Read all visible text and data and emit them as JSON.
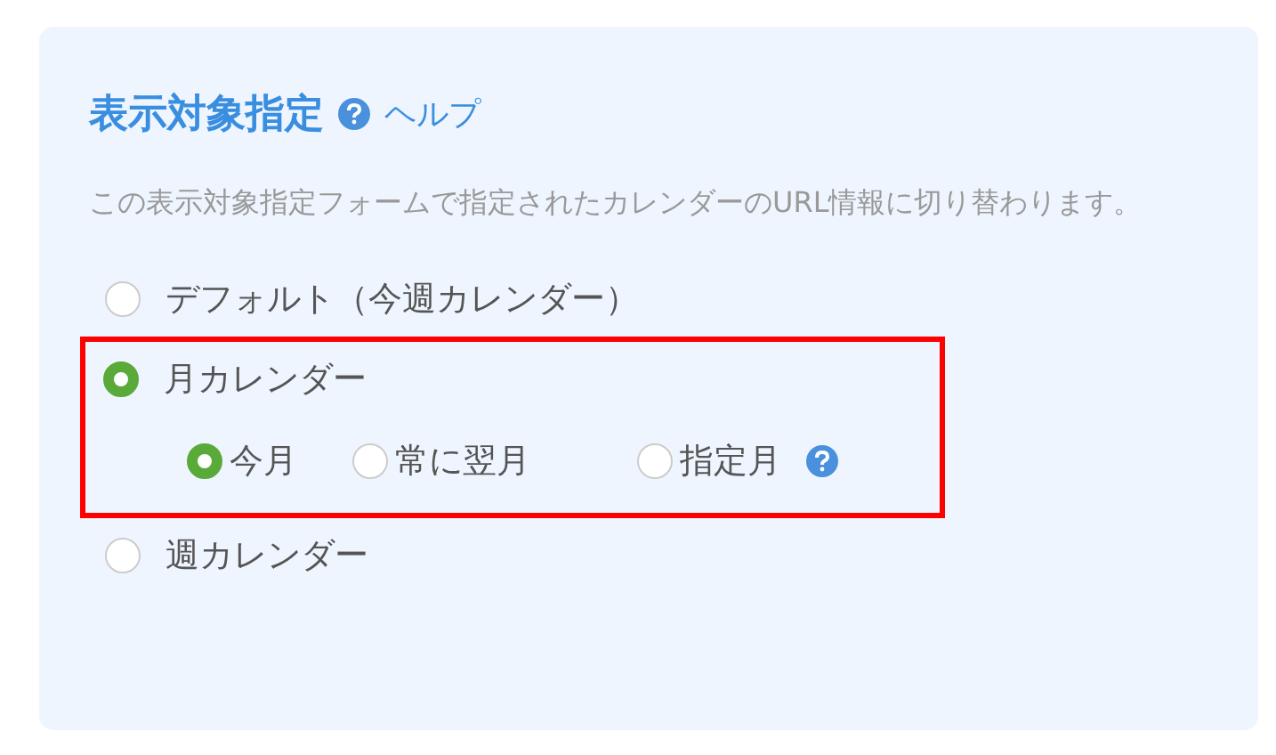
{
  "title": "表示対象指定",
  "help_link": "ヘルプ",
  "description": "この表示対象指定フォームで指定されたカレンダーのURL情報に切り替わります。",
  "options": [
    {
      "label": "デフォルト（今週カレンダー）",
      "selected": false,
      "highlighted": false
    },
    {
      "label": "月カレンダー",
      "selected": true,
      "highlighted": true,
      "sub_options": [
        {
          "label": "今月",
          "selected": true,
          "help": false
        },
        {
          "label": "常に翌月",
          "selected": false,
          "help": false
        },
        {
          "label": "指定月",
          "selected": false,
          "help": true
        }
      ]
    },
    {
      "label": "週カレンダー",
      "selected": false,
      "highlighted": false
    }
  ]
}
